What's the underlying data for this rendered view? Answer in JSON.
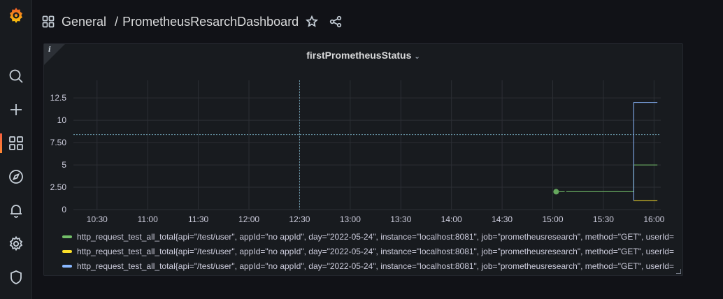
{
  "sidebar": {
    "items": [
      {
        "name": "grafana-logo-icon"
      },
      {
        "name": "search-icon"
      },
      {
        "name": "plus-icon"
      },
      {
        "name": "dashboards-icon",
        "active": true
      },
      {
        "name": "compass-icon"
      },
      {
        "name": "bell-icon"
      },
      {
        "name": "gear-icon"
      },
      {
        "name": "shield-icon"
      }
    ],
    "accent": "#f55f3e"
  },
  "header": {
    "folder": "General",
    "separator": "/",
    "dashboard_title": "PrometheusResarchDashboard"
  },
  "panel": {
    "info_glyph": "i",
    "title": "firstPrometheusStatus",
    "chevron": "⌄"
  },
  "chart_data": {
    "type": "line",
    "x_ticks": [
      "10:30",
      "11:00",
      "11:30",
      "12:00",
      "12:30",
      "13:00",
      "13:30",
      "14:00",
      "14:30",
      "15:00",
      "15:30",
      "16:00"
    ],
    "y_ticks": [
      "0",
      "2.50",
      "5",
      "7.50",
      "10",
      "12.5"
    ],
    "ylim": [
      0,
      14
    ],
    "xlim": [
      "10:16",
      "16:04"
    ],
    "crosshair_x": "12:30",
    "crosshair_y": 8.4,
    "grid": true,
    "legend_position": "bottom",
    "series": [
      {
        "name": "http_request_test_all_total{api=\"/test/user\", appId=\"no appId\", day=\"2022-05-24\", instance=\"localhost:8081\", job=\"prometheusresearch\", method=\"GET\", userId=",
        "color": "#73bf69",
        "points": [
          [
            "15:02",
            2
          ],
          [
            "15:05",
            2
          ],
          [
            "15:08",
            2
          ],
          [
            "15:48",
            2
          ],
          [
            "15:48",
            5
          ],
          [
            "16:02",
            5
          ]
        ]
      },
      {
        "name": "http_request_test_all_total{api=\"/test/user\", appId=\"no appId\", day=\"2022-05-24\", instance=\"localhost:8081\", job=\"prometheusresearch\", method=\"GET\", userId=",
        "color": "#fade2a",
        "points": [
          [
            "15:48",
            1
          ],
          [
            "16:02",
            1
          ]
        ]
      },
      {
        "name": "http_request_test_all_total{api=\"/test/user\", appId=\"no appId\", day=\"2022-05-24\", instance=\"localhost:8081\", job=\"prometheusresearch\", method=\"GET\", userId=",
        "color": "#8ab8ff",
        "points": [
          [
            "15:48",
            1
          ],
          [
            "15:48",
            12
          ],
          [
            "16:02",
            12
          ]
        ]
      }
    ]
  }
}
